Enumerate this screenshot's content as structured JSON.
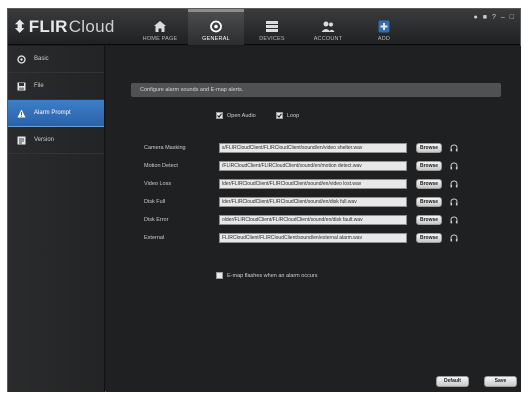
{
  "app": {
    "logo_main": "FLIR",
    "logo_sub": "Cloud"
  },
  "nav": [
    {
      "label": "HOME PAGE",
      "icon": "home-icon"
    },
    {
      "label": "GENERAL",
      "icon": "general-icon",
      "active": true
    },
    {
      "label": "DEVICES",
      "icon": "devices-icon"
    },
    {
      "label": "ACCOUNT",
      "icon": "account-icon"
    },
    {
      "label": "ADD",
      "icon": "add-icon"
    }
  ],
  "window_controls": [
    "user-icon",
    "menu-icon",
    "help-icon",
    "minimize-icon",
    "close-icon"
  ],
  "sidebar": [
    {
      "label": "Basic",
      "icon": "basic-icon"
    },
    {
      "label": "File",
      "icon": "file-icon"
    },
    {
      "label": "Alarm Prompt",
      "icon": "alarm-icon",
      "active": true
    },
    {
      "label": "Version",
      "icon": "version-icon"
    }
  ],
  "main": {
    "header": "Configure alarm sounds and E-map alerts.",
    "open_audio_label": "Open Audio",
    "open_audio_checked": true,
    "loop_label": "Loop",
    "loop_checked": true,
    "rows": [
      {
        "label": "Camera Masking",
        "path": "s/FLIRCloudClient/FLIRCloudClient/sound/en/video shelter.wav",
        "browse": "Browse"
      },
      {
        "label": "Motion Detect",
        "path": "/FLIRCloudClient/FLIRCloudClient/sound/en/motion detect.wav",
        "browse": "Browse"
      },
      {
        "label": "Video Loss",
        "path": "lder/FLIRCloudClient/FLIRCloudClient/sound/en/video lost.wav",
        "browse": "Browse"
      },
      {
        "label": "Disk Full",
        "path": "lder/FLIRCloudClient/FLIRCloudClient/sound/en/disk full.wav",
        "browse": "Browse"
      },
      {
        "label": "Disk Error",
        "path": "older/FLIRCloudClient/FLIRCloudClient/sound/en/disk fault.wav",
        "browse": "Browse"
      },
      {
        "label": "External",
        "path": "FLIRCloudClient/FLIRCloudClient/sound/en/external alarm.wav",
        "browse": "Browse"
      }
    ],
    "emap_label": "E-map flashes when an alarm occurs",
    "emap_checked": false,
    "default_button": "Default",
    "save_button": "Save"
  },
  "colors": {
    "accent": "#2f6db5",
    "background": "#1f2021",
    "sidebar": "#262728"
  }
}
